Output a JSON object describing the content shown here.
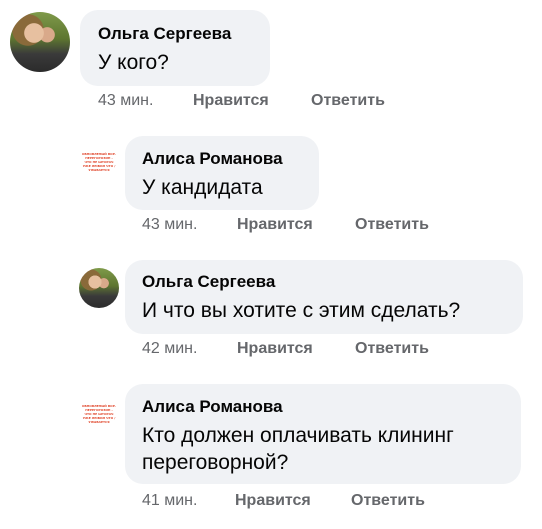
{
  "comments": [
    {
      "author": "Ольга Сергеева",
      "text": "У кого?",
      "time": "43 мин.",
      "like": "Нравится",
      "reply": "Ответить",
      "avatar": "photo"
    },
    {
      "author": "Алиса Романова",
      "text": "У кандидата",
      "time": "43 мин.",
      "like": "Нравится",
      "reply": "Ответить",
      "avatar": "text-image",
      "avatar_lines": [
        "ОБНОВЛЕНЫЙ ВОР.",
        "ПЕРЕГОРОЗИН -",
        "ЧТО НЕ ШТОРАЧ",
        "УЖЕ ЛЮБИЛ ЧТО /",
        "УЛЫБАЕТСЯ"
      ]
    },
    {
      "author": "Ольга Сергеева",
      "text": "И что вы хотите с этим сделать?",
      "time": "42 мин.",
      "like": "Нравится",
      "reply": "Ответить",
      "avatar": "photo"
    },
    {
      "author": "Алиса Романова",
      "text": "Кто должен оплачивать клининг\nпереговорной?",
      "time": "41 мин.",
      "like": "Нравится",
      "reply": "Ответить",
      "avatar": "text-image",
      "avatar_lines": [
        "ОБНОВЛЕНЫЙ ВОР.",
        "ПЕРЕГОРОЗИН -",
        "ЧТО НЕ ШТОРАЧ",
        "УЖЕ ЛЮБИЛ ЧТО /",
        "УЛЫБАЕТСЯ"
      ]
    }
  ],
  "colors": {
    "bubble": "#f0f2f5",
    "meta": "#65676b",
    "text": "#050505"
  }
}
